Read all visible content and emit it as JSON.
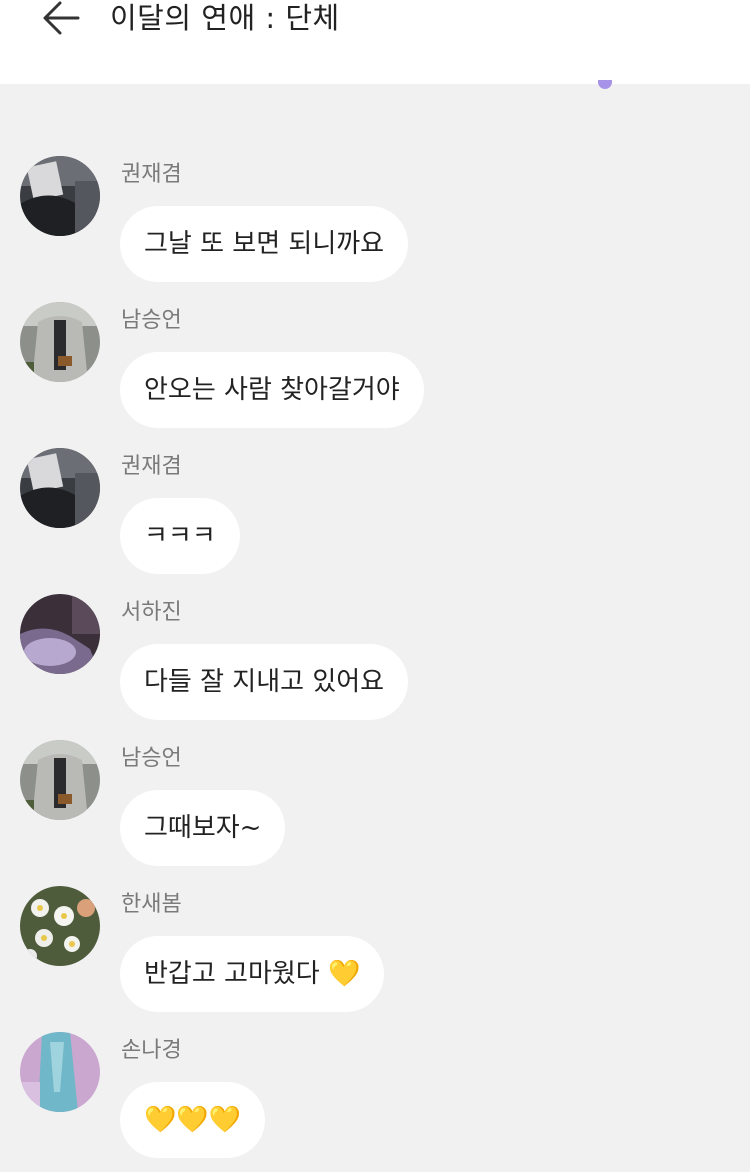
{
  "header": {
    "title": "이달의 연애 : 단체",
    "back_icon": "arrow-left-icon"
  },
  "colors": {
    "header_bg": "#ffffff",
    "chat_bg": "#f1f1f1",
    "bubble_bg": "#ffffff",
    "sender_text": "#7a7a7a",
    "accent": "#a693e8"
  },
  "messages": [
    {
      "sender": "권재겸",
      "text": "그날 또 보면 되니까요",
      "avatar": "avatar-dark-figure"
    },
    {
      "sender": "남승언",
      "text": "안오는 사람 찾아갈거야",
      "avatar": "avatar-grey-jacket"
    },
    {
      "sender": "권재겸",
      "text": "ㅋㅋㅋ",
      "avatar": "avatar-dark-figure"
    },
    {
      "sender": "서하진",
      "text": "다들 잘 지내고 있어요",
      "avatar": "avatar-purple-knee"
    },
    {
      "sender": "남승언",
      "text": "그때보자~",
      "avatar": "avatar-grey-jacket"
    },
    {
      "sender": "한새봄",
      "text": "반갑고 고마웠다 💛",
      "avatar": "avatar-daisy-flowers"
    },
    {
      "sender": "손나경",
      "text": "💛💛💛",
      "avatar": "avatar-teal-scarf"
    }
  ]
}
